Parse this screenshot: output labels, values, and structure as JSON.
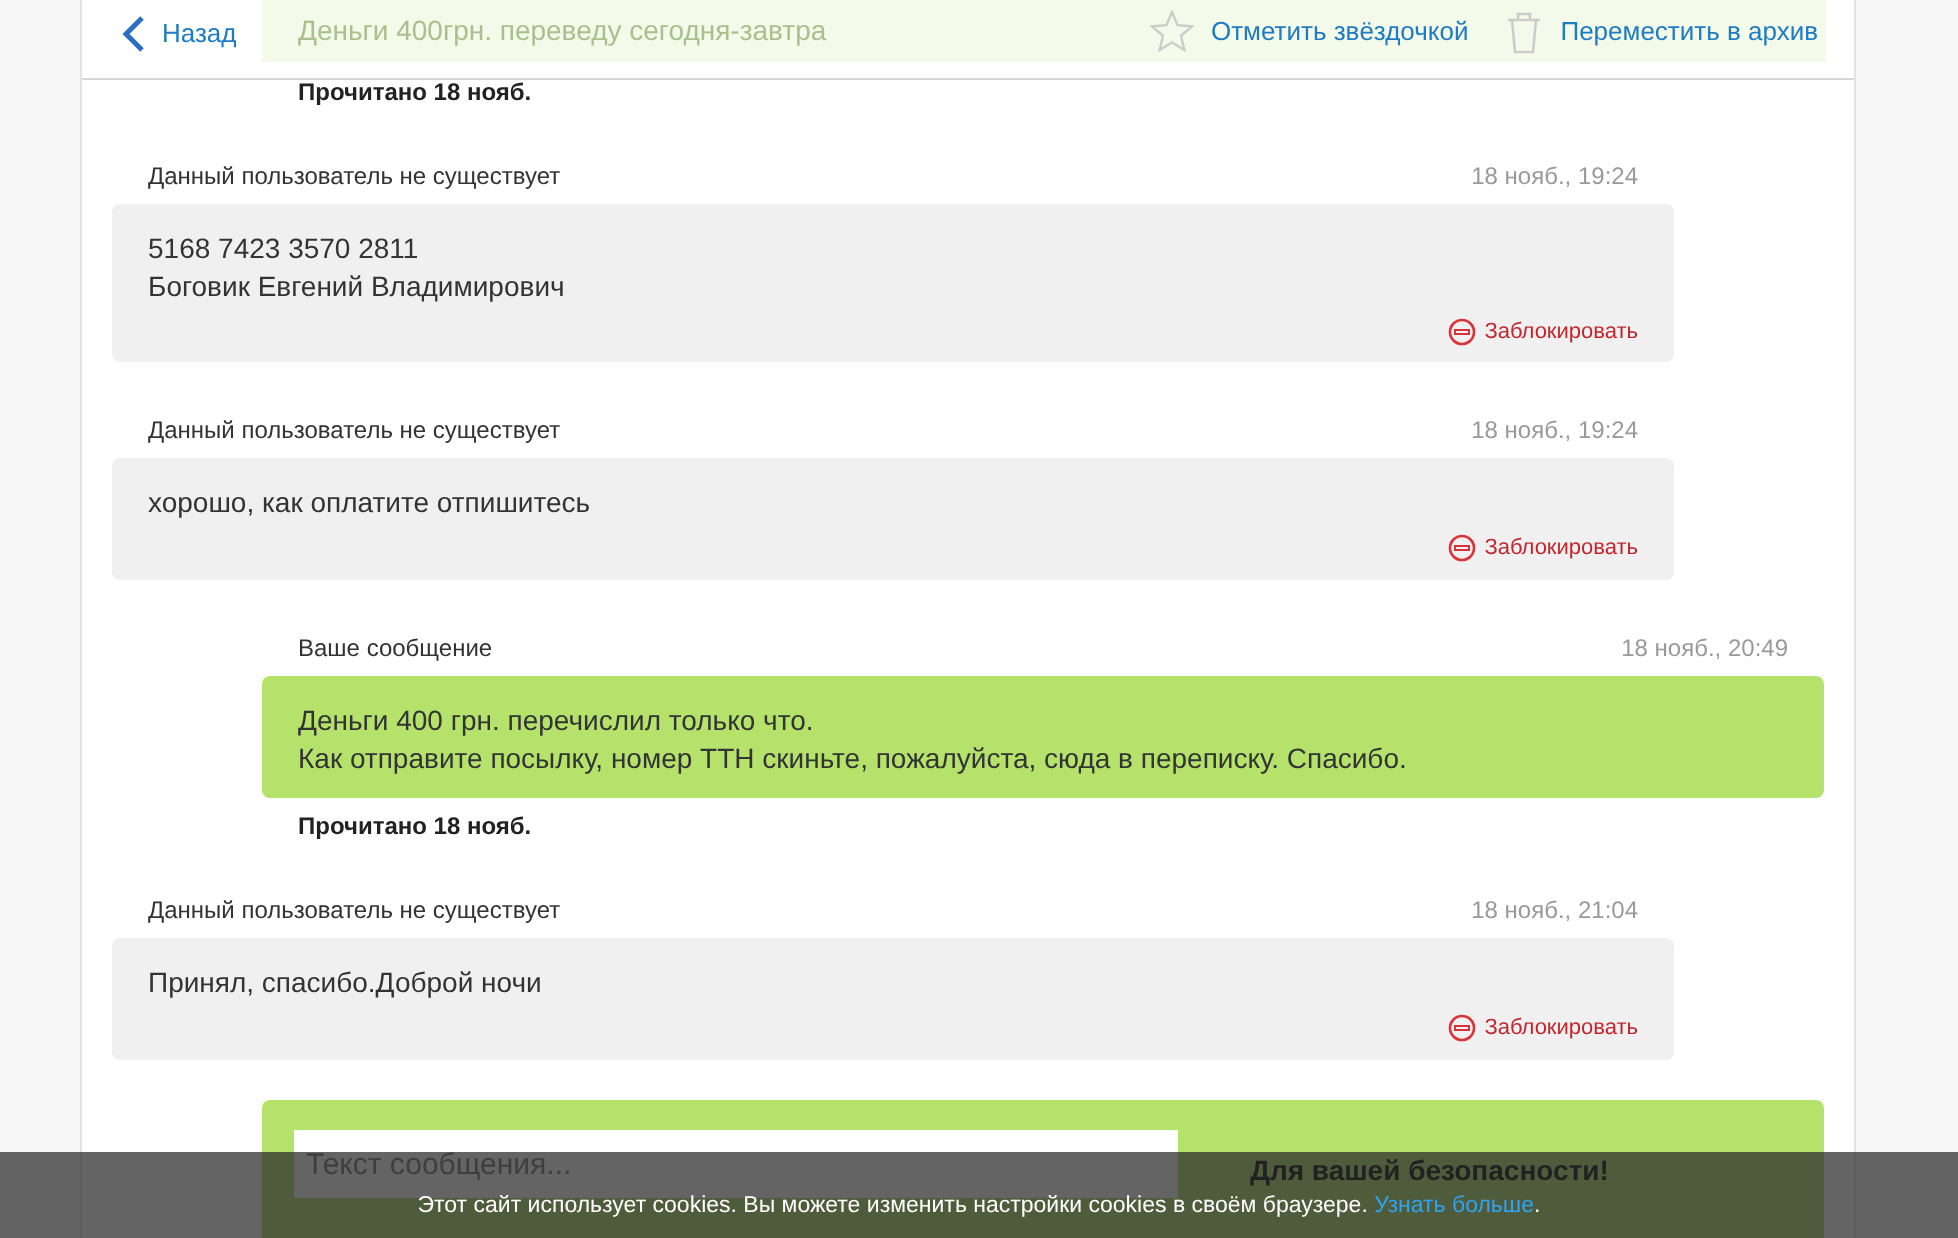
{
  "header": {
    "back": "Назад",
    "preview": "Деньги 400грн. переведу сегодня-завтра",
    "star": "Отметить звёздочкой",
    "archive": "Переместить в архив"
  },
  "top_read": "Прочитано 18 нояб.",
  "messages": [
    {
      "kind": "incoming",
      "author": "Данный пользователь не существует",
      "time": "18 нояб., 19:24",
      "text": "5168 7423 3570 2811\nБоговик Евгений Владимирович",
      "block": "Заблокировать"
    },
    {
      "kind": "incoming",
      "author": "Данный пользователь не существует",
      "time": "18 нояб., 19:24",
      "text": "хорошо, как оплатите отпишитесь",
      "block": "Заблокировать"
    },
    {
      "kind": "outgoing",
      "author": "Ваше сообщение",
      "time": "18 нояб., 20:49",
      "text": "Деньги 400 грн. перечислил только что.\nКак отправите посылку, номер ТТН скиньте, пожалуйста, сюда в переписку. Спасибо.",
      "read": "Прочитано 18 нояб."
    },
    {
      "kind": "incoming",
      "author": "Данный пользователь не существует",
      "time": "18 нояб., 21:04",
      "text": "Принял, спасибо.Доброй ночи",
      "block": "Заблокировать"
    }
  ],
  "compose": {
    "placeholder": "Текст сообщения...",
    "safety": "Для вашей безопасности!"
  },
  "cookie": {
    "text": "Этот сайт использует cookies. Вы можете изменить настройки cookies в своём браузере.",
    "link": "Узнать больше",
    "end": "."
  }
}
